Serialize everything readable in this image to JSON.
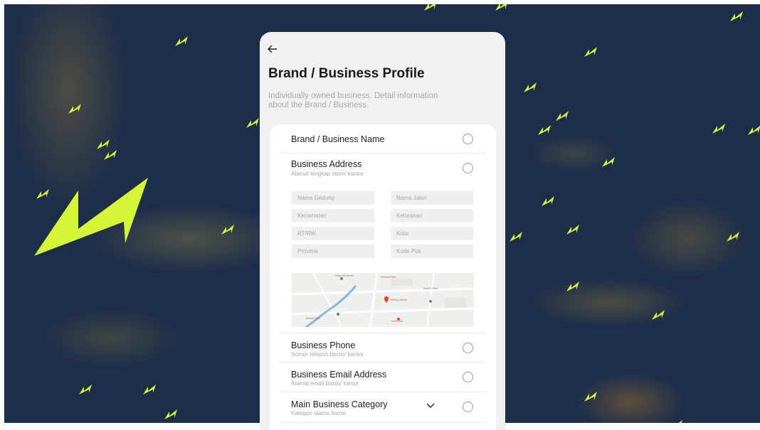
{
  "colors": {
    "background": "#1c2e4a",
    "accent_bolt": "#d4f436",
    "card": "#f1f1f1",
    "panel": "#ffffff"
  },
  "header": {
    "back_icon": "arrow-left-icon",
    "title": "Brand / Business Profile",
    "description": "Individually owned business. Detail information about the Brand / Business."
  },
  "rows": {
    "brand_name": {
      "title": "Brand / Business Name",
      "subtitle": ""
    },
    "address": {
      "title": "Business Address",
      "subtitle": "Alamat lengkap store/ kantor"
    },
    "phone": {
      "title": "Business Phone",
      "subtitle": "Nomor telepon bisnis/ kantor"
    },
    "email": {
      "title": "Business Email Address",
      "subtitle": "Alamat email bisnis/ kantor"
    },
    "category": {
      "title": "Main Business Category",
      "subtitle": "Kategori utama bisnis"
    }
  },
  "address_fields": {
    "building": {
      "placeholder": "Nama Gedung"
    },
    "street": {
      "placeholder": "Nama Jalan"
    },
    "district": {
      "placeholder": "Kecamatan"
    },
    "subdistrict": {
      "placeholder": "Kelurahan"
    },
    "rtrw": {
      "placeholder": "RT/RW"
    },
    "city": {
      "placeholder": "Kota"
    },
    "province": {
      "placeholder": "Provinsi"
    },
    "postal": {
      "placeholder": "Kode Pos"
    }
  },
  "map": {
    "labels": {
      "park": "Taman Sri Tamah",
      "school": "Sekolah SMA",
      "office": "Kantor Dinas",
      "pin": "Gedung Utama",
      "hospital": "Rumah Sakit",
      "hotel": "Hotel Kota"
    }
  }
}
